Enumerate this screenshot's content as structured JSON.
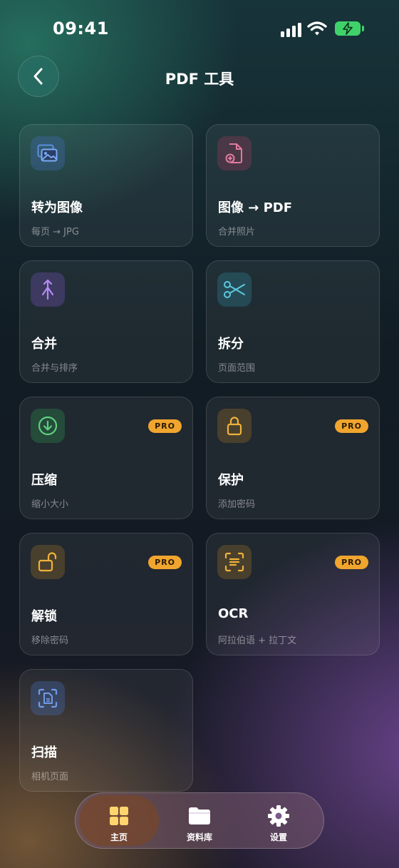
{
  "status_bar": {
    "time": "09:41"
  },
  "header": {
    "title": "PDF 工具"
  },
  "tools": [
    {
      "title": "转为图像",
      "subtitle": "每页 → JPG",
      "icon": "images-icon",
      "pro": false
    },
    {
      "title": "图像 → PDF",
      "subtitle": "合并照片",
      "icon": "file-add-icon",
      "pro": false
    },
    {
      "title": "合并",
      "subtitle": "合并与排序",
      "icon": "merge-icon",
      "pro": false
    },
    {
      "title": "拆分",
      "subtitle": "页面范围",
      "icon": "scissors-icon",
      "pro": false
    },
    {
      "title": "压缩",
      "subtitle": "缩小大小",
      "icon": "download-circle-icon",
      "pro": true
    },
    {
      "title": "保护",
      "subtitle": "添加密码",
      "icon": "lock-icon",
      "pro": true
    },
    {
      "title": "解锁",
      "subtitle": "移除密码",
      "icon": "unlock-icon",
      "pro": true
    },
    {
      "title": "OCR",
      "subtitle": "阿拉伯语 + 拉丁文",
      "icon": "text-scan-icon",
      "pro": true
    },
    {
      "title": "扫描",
      "subtitle": "相机页面",
      "icon": "document-scan-icon",
      "pro": false
    }
  ],
  "pro_badge": "PRO",
  "tab_bar": {
    "active": "主页",
    "items": [
      {
        "label": "主页",
        "icon": "grid-icon"
      },
      {
        "label": "资料库",
        "icon": "folder-icon"
      },
      {
        "label": "设置",
        "icon": "gear-icon"
      }
    ]
  },
  "colors": {
    "pro": "#f0a52e",
    "accent_teal": "#2b6e64",
    "battery": "#3fd26a"
  }
}
